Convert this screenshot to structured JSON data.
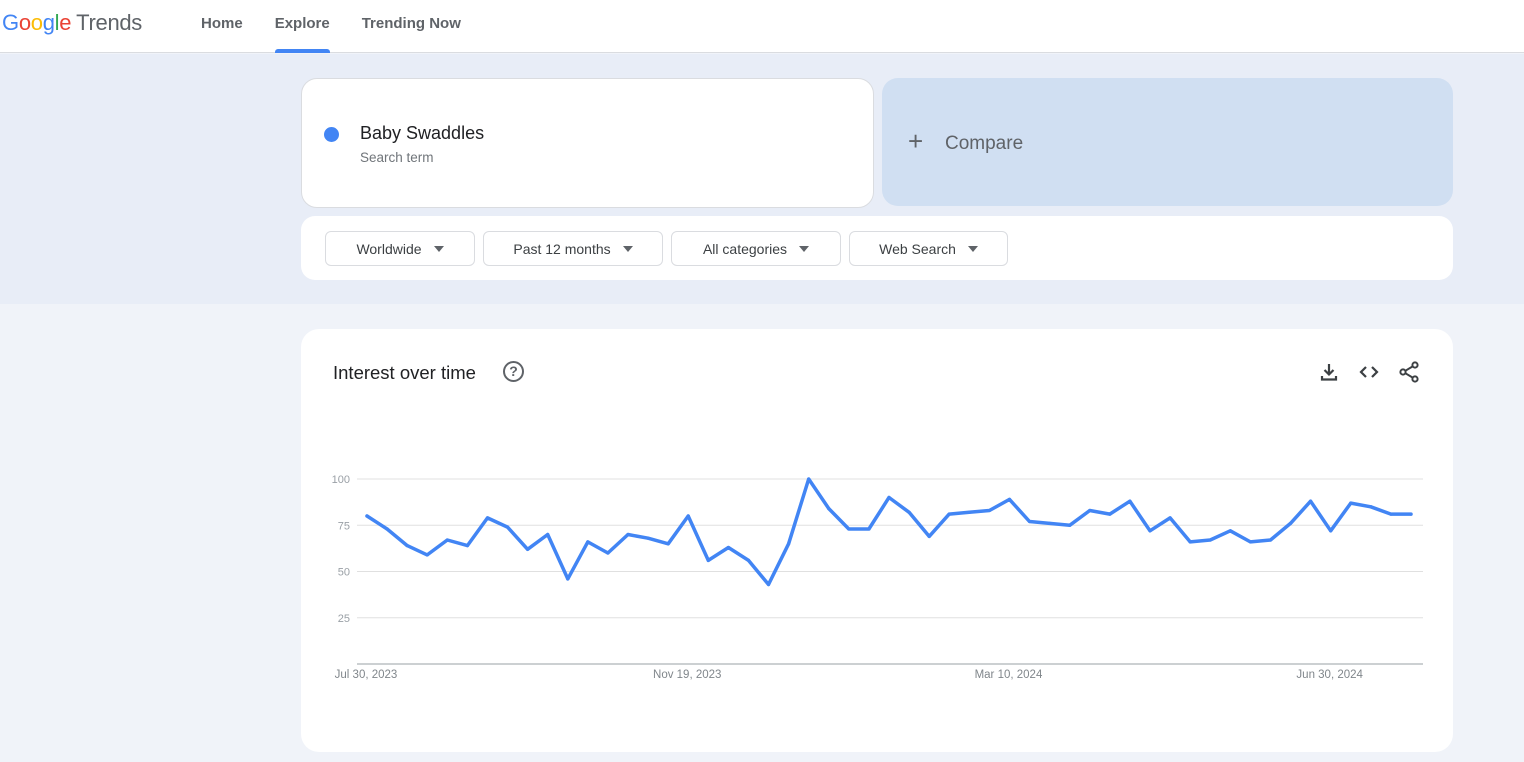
{
  "header": {
    "logo": {
      "google": [
        "G",
        "o",
        "o",
        "g",
        "l",
        "e"
      ],
      "product": "Trends"
    },
    "nav": [
      {
        "label": "Home",
        "active": false
      },
      {
        "label": "Explore",
        "active": true
      },
      {
        "label": "Trending Now",
        "active": false
      }
    ]
  },
  "search_term": {
    "name": "Baby Swaddles",
    "type": "Search term",
    "color": "#4285f4"
  },
  "compare": {
    "icon": "plus-icon",
    "label": "Compare"
  },
  "filters": [
    {
      "label": "Worldwide"
    },
    {
      "label": "Past 12 months"
    },
    {
      "label": "All categories"
    },
    {
      "label": "Web Search"
    }
  ],
  "interest_card": {
    "title": "Interest over time",
    "help_icon": "?",
    "actions": [
      "download-icon",
      "embed-code-icon",
      "share-icon"
    ]
  },
  "chart_data": {
    "type": "line",
    "title": "Interest over time",
    "xlabel": "",
    "ylabel": "",
    "ylim": [
      0,
      100
    ],
    "yticks": [
      25,
      50,
      75,
      100
    ],
    "xtick_labels": [
      {
        "label": "Jul 30, 2023",
        "index": 0
      },
      {
        "label": "Nov 19, 2023",
        "index": 16
      },
      {
        "label": "Mar 10, 2024",
        "index": 32
      },
      {
        "label": "Jun 30, 2024",
        "index": 48
      }
    ],
    "grid": true,
    "legend": "none",
    "series": [
      {
        "name": "Baby Swaddles",
        "color": "#4285f4",
        "values": [
          80,
          73,
          64,
          59,
          67,
          64,
          79,
          74,
          62,
          70,
          46,
          66,
          60,
          70,
          68,
          65,
          80,
          56,
          63,
          56,
          43,
          65,
          100,
          84,
          73,
          73,
          90,
          82,
          69,
          81,
          82,
          83,
          89,
          77,
          76,
          75,
          83,
          81,
          88,
          72,
          79,
          66,
          67,
          72,
          66,
          67,
          76,
          88,
          72,
          87,
          85,
          81,
          81
        ]
      }
    ]
  }
}
